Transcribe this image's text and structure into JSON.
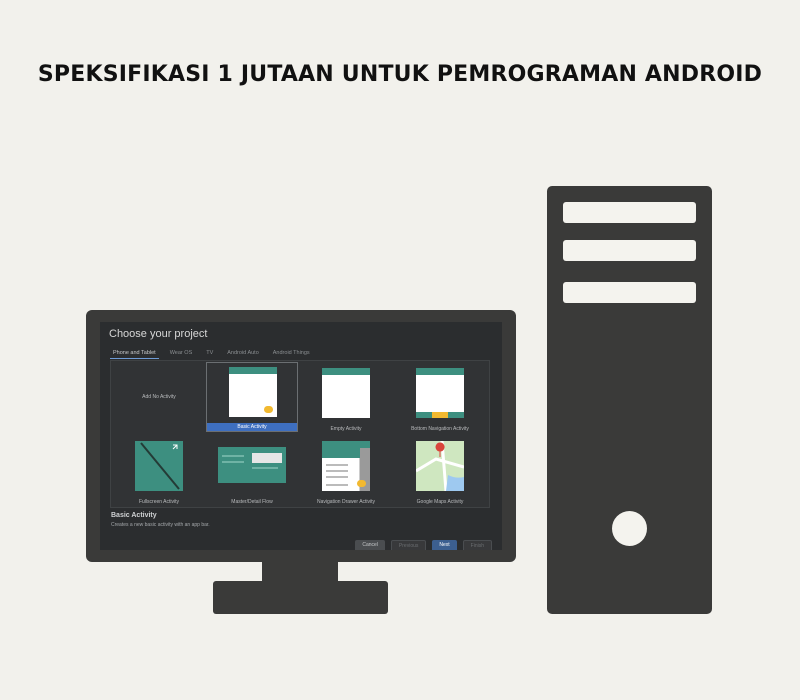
{
  "heading": "SPEKSIFIKASI 1 JUTAAN UNTUK PEMROGRAMAN ANDROID",
  "screen": {
    "title": "Choose your project",
    "tabs": [
      "Phone and Tablet",
      "Wear OS",
      "TV",
      "Android Auto",
      "Android Things"
    ],
    "active_tab": "Phone and Tablet",
    "templates": [
      "Add No Activity",
      "Basic Activity",
      "Empty Activity",
      "Bottom Navigation Activity",
      "Fullscreen Activity",
      "Master/Detail Flow",
      "Navigation Drawer Activity",
      "Google Maps Activity"
    ],
    "selected_template": "Basic Activity",
    "selected_title": "Basic Activity",
    "selected_description": "Creates a new basic activity with an app bar.",
    "buttons": {
      "cancel": "Cancel",
      "previous": "Previous",
      "next": "Next",
      "finish": "Finish"
    }
  },
  "colors": {
    "background": "#f2f1ec",
    "device": "#3a3a39",
    "accent_teal": "#3d8f80",
    "accent_yellow": "#f2b930",
    "selection_blue": "#3e6fc0"
  }
}
